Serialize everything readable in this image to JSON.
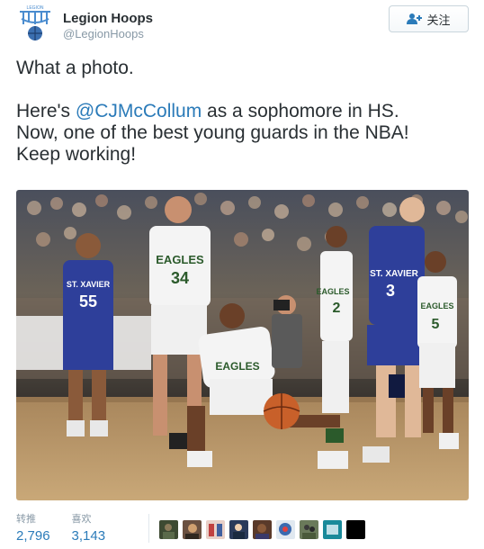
{
  "user": {
    "name": "Legion Hoops",
    "handle": "@LegionHoops",
    "avatar_text": "LEGION"
  },
  "follow": {
    "label": "关注",
    "icon": "add-user-icon"
  },
  "tweet": {
    "line1": "What a photo.",
    "para2_prefix": "Here's ",
    "mention": "@CJMcCollum",
    "para2_suffix": " as a sophomore in HS.",
    "line3": "Now, one of the best young guards in the NBA!",
    "line4": "Keep working!"
  },
  "photo": {
    "jersey_left": "ST. XAVIER",
    "jersey_left_num": "55",
    "jersey_center": "EAGLES",
    "jersey_center_num": "34",
    "jersey_crouch": "EAGLES",
    "jersey_right": "ST. XAVIER",
    "jersey_right_num": "3",
    "jersey_far_right": "EAGLES",
    "jersey_far_right_num": "5",
    "jersey_mid_right": "EAGLES",
    "jersey_mid_right_num": "2"
  },
  "stats": {
    "retweets_label": "转推",
    "retweets_value": "2,796",
    "likes_label": "喜欢",
    "likes_value": "3,143"
  },
  "colors": {
    "accent": "#2b7bb9",
    "text": "#292f33",
    "muted": "#8899a6"
  }
}
